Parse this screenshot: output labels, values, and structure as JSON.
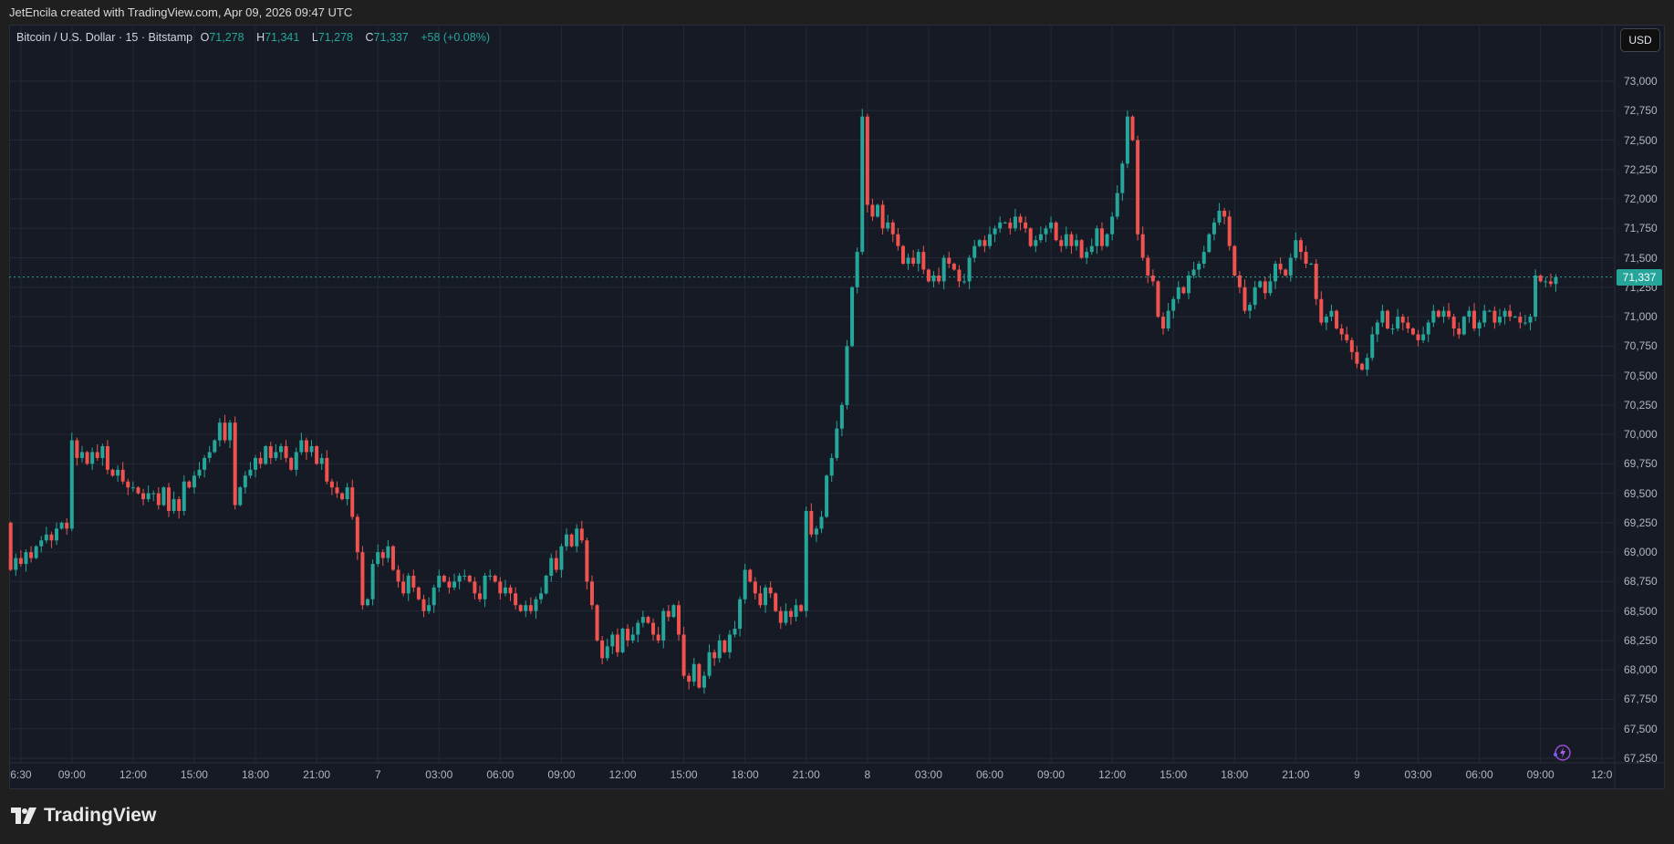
{
  "credit": "JetEncila created with TradingView.com, Apr 09, 2026 09:47 UTC",
  "legend": {
    "symbol": "Bitcoin / U.S. Dollar · 15 · Bitstamp",
    "o_label": "O",
    "o": "71,278",
    "h_label": "H",
    "h": "71,341",
    "l_label": "L",
    "l": "71,278",
    "c_label": "C",
    "c": "71,337",
    "change": "+58 (+0.08%)"
  },
  "currency_button": "USD",
  "last_price_label": "71,337",
  "footer_logo": "TradingView",
  "colors": {
    "up": "#26a69a",
    "down": "#ef5350",
    "background": "#161a25",
    "grid": "#242935"
  },
  "chart_data": {
    "type": "candlestick",
    "title": "Bitcoin / U.S. Dollar · 15 · Bitstamp",
    "interval_minutes": 15,
    "start": "Apr 06 06:00",
    "first_open": 69250,
    "last_price": 71337,
    "ylim": [
      67250,
      73000
    ],
    "y_ticks": [
      "73,000",
      "72,750",
      "72,500",
      "72,250",
      "72,000",
      "71,750",
      "71,500",
      "71,250",
      "71,000",
      "70,750",
      "70,500",
      "70,250",
      "70,000",
      "69,750",
      "69,500",
      "69,250",
      "69,000",
      "68,750",
      "68,500",
      "68,250",
      "68,000",
      "67,750",
      "67,500",
      "67,250"
    ],
    "x_ticks": [
      {
        "label": "6:30",
        "index": 2
      },
      {
        "label": "09:00",
        "index": 12
      },
      {
        "label": "12:00",
        "index": 24
      },
      {
        "label": "15:00",
        "index": 36
      },
      {
        "label": "18:00",
        "index": 48
      },
      {
        "label": "21:00",
        "index": 60
      },
      {
        "label": "7",
        "index": 72
      },
      {
        "label": "03:00",
        "index": 84
      },
      {
        "label": "06:00",
        "index": 96
      },
      {
        "label": "09:00",
        "index": 108
      },
      {
        "label": "12:00",
        "index": 120
      },
      {
        "label": "15:00",
        "index": 132
      },
      {
        "label": "18:00",
        "index": 144
      },
      {
        "label": "21:00",
        "index": 156
      },
      {
        "label": "8",
        "index": 168
      },
      {
        "label": "03:00",
        "index": 180
      },
      {
        "label": "06:00",
        "index": 192
      },
      {
        "label": "09:00",
        "index": 204
      },
      {
        "label": "12:00",
        "index": 216
      },
      {
        "label": "15:00",
        "index": 228
      },
      {
        "label": "18:00",
        "index": 240
      },
      {
        "label": "21:00",
        "index": 252
      },
      {
        "label": "9",
        "index": 264
      },
      {
        "label": "03:00",
        "index": 276
      },
      {
        "label": "06:00",
        "index": 288
      },
      {
        "label": "09:00",
        "index": 300
      },
      {
        "label": "12:0",
        "index": 312
      }
    ],
    "closes": [
      68850,
      68950,
      68900,
      69000,
      68950,
      69050,
      69100,
      69150,
      69100,
      69200,
      69250,
      69200,
      69950,
      69800,
      69850,
      69750,
      69850,
      69800,
      69900,
      69700,
      69650,
      69700,
      69600,
      69550,
      69550,
      69500,
      69450,
      69500,
      69500,
      69400,
      69550,
      69350,
      69450,
      69350,
      69600,
      69550,
      69650,
      69700,
      69800,
      69850,
      69950,
      70100,
      69950,
      70100,
      69400,
      69550,
      69650,
      69700,
      69800,
      69750,
      69900,
      69800,
      69850,
      69900,
      69800,
      69700,
      69850,
      69950,
      69850,
      69900,
      69750,
      69800,
      69600,
      69550,
      69500,
      69450,
      69550,
      69300,
      69000,
      68550,
      68600,
      68900,
      69000,
      68950,
      69050,
      68850,
      68750,
      68650,
      68800,
      68700,
      68600,
      68500,
      68550,
      68700,
      68800,
      68750,
      68700,
      68750,
      68800,
      68800,
      68750,
      68650,
      68600,
      68800,
      68800,
      68750,
      68650,
      68700,
      68650,
      68550,
      68500,
      68550,
      68500,
      68600,
      68650,
      68800,
      68950,
      68850,
      69050,
      69150,
      69050,
      69200,
      69100,
      68750,
      68550,
      68250,
      68100,
      68200,
      68300,
      68150,
      68350,
      68250,
      68300,
      68400,
      68450,
      68400,
      68300,
      68250,
      68500,
      68450,
      68550,
      68300,
      67950,
      67900,
      68050,
      67850,
      67950,
      68150,
      68100,
      68250,
      68150,
      68300,
      68350,
      68600,
      68850,
      68750,
      68650,
      68550,
      68700,
      68650,
      68500,
      68400,
      68500,
      68450,
      68550,
      68500,
      69350,
      69150,
      69200,
      69300,
      69650,
      69800,
      70050,
      70250,
      70750,
      71250,
      71550,
      72700,
      71950,
      71850,
      71950,
      71750,
      71800,
      71700,
      71600,
      71450,
      71500,
      71450,
      71550,
      71400,
      71300,
      71350,
      71300,
      71500,
      71450,
      71400,
      71300,
      71300,
      71500,
      71600,
      71650,
      71600,
      71700,
      71750,
      71800,
      71800,
      71750,
      71850,
      71800,
      71750,
      71600,
      71650,
      71700,
      71750,
      71800,
      71650,
      71600,
      71700,
      71600,
      71650,
      71500,
      71550,
      71600,
      71750,
      71600,
      71700,
      71850,
      72050,
      72300,
      72700,
      72500,
      71700,
      71500,
      71350,
      71300,
      71000,
      70900,
      71050,
      71150,
      71250,
      71200,
      71350,
      71400,
      71450,
      71550,
      71700,
      71800,
      71900,
      71850,
      71600,
      71350,
      71250,
      71050,
      71100,
      71250,
      71300,
      71200,
      71300,
      71450,
      71400,
      71350,
      71500,
      71650,
      71550,
      71450,
      71450,
      71150,
      70950,
      71000,
      71050,
      70900,
      70850,
      70800,
      70700,
      70600,
      70550,
      70650,
      70850,
      70950,
      71050,
      70900,
      70900,
      71000,
      70950,
      70900,
      70850,
      70800,
      70850,
      70950,
      71050,
      71000,
      71050,
      71000,
      70900,
      70850,
      71000,
      71050,
      70900,
      70950,
      71050,
      71050,
      70950,
      71000,
      71050,
      71000,
      71000,
      70950,
      70950,
      71000,
      71350,
      71300,
      71300,
      71278,
      71337
    ]
  }
}
